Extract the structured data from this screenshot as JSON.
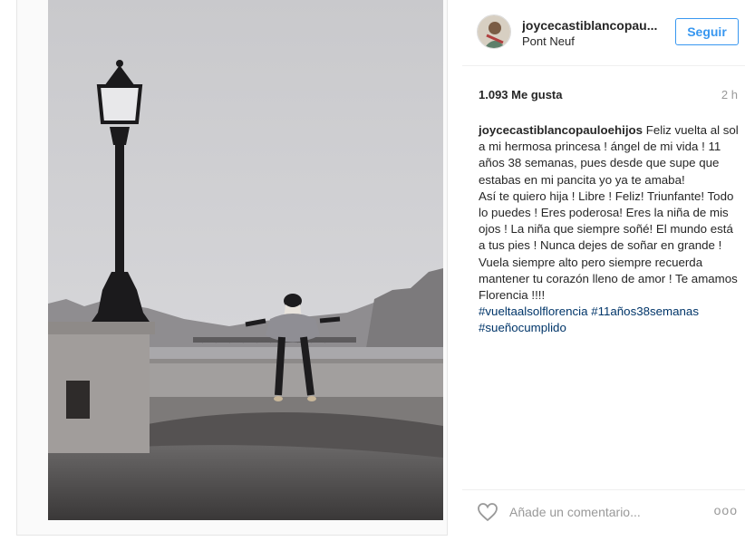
{
  "header": {
    "username": "joycecastiblancopau...",
    "location": "Pont Neuf",
    "follow_label": "Seguir"
  },
  "stats": {
    "likes": "1.093 Me gusta",
    "time": "2 h"
  },
  "caption": {
    "user": "joycecastiblancopauloehijos",
    "text": "Feliz vuelta al sol a mi hermosa princesa ! ángel de mi vida ! 11 años 38 semanas, pues desde que supe que estabas en mi pancita yo ya te amaba!",
    "text2": "Así te quiero hija ! Libre ! Feliz! Triunfante! Todo lo puedes ! Eres poderosa! Eres la niña de mis ojos ! La niña que siempre soñé! El mundo está a tus pies ! Nunca dejes de soñar en grande ! Vuela siempre alto pero siempre recuerda mantener tu corazón lleno de amor ! Te amamos Florencia !!!!",
    "hashtags": [
      "#vueltaalsolflorencia",
      "#11años38semanas",
      "#sueñocumplido"
    ]
  },
  "comment": {
    "placeholder": "Añade un comentario...",
    "more": "ooo"
  },
  "icons": {
    "like": "heart-icon",
    "options": "more-options-icon"
  },
  "colors": {
    "accent": "#3897f0",
    "hashtag": "#003569"
  }
}
